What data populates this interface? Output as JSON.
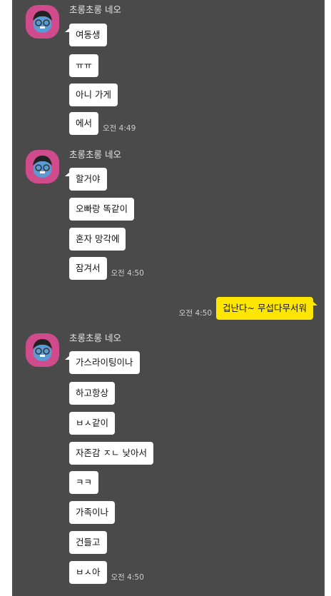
{
  "groups": [
    {
      "sender": "초롱초롱 네오",
      "messages": [
        "여동생",
        "ㅠㅠ",
        "아니 가게",
        "에서"
      ],
      "time": "오전 4:49"
    },
    {
      "sender": "초롱초롱 네오",
      "messages": [
        "할거야",
        "오빠랑 똑같이",
        "혼자 망각에",
        "잠겨서"
      ],
      "time": "오전 4:50"
    },
    {
      "sender": "초롱초롱 네오",
      "messages": [
        "가스라이팅이나",
        "하고항상",
        "ㅂㅅ같이",
        "자존감 ㅈㄴ 낮아서",
        "ㅋㅋ",
        "가족이나",
        "건들고",
        "ㅂㅅ아"
      ],
      "time": "오전 4:50"
    }
  ],
  "my_message": {
    "text": "겁난다~ 무섭다무서워",
    "time": "오전 4:50"
  },
  "colors": {
    "background": "#4a4a4a",
    "my_bubble": "#ffe600",
    "their_bubble": "#ffffff",
    "avatar": "#cf4b8c"
  }
}
